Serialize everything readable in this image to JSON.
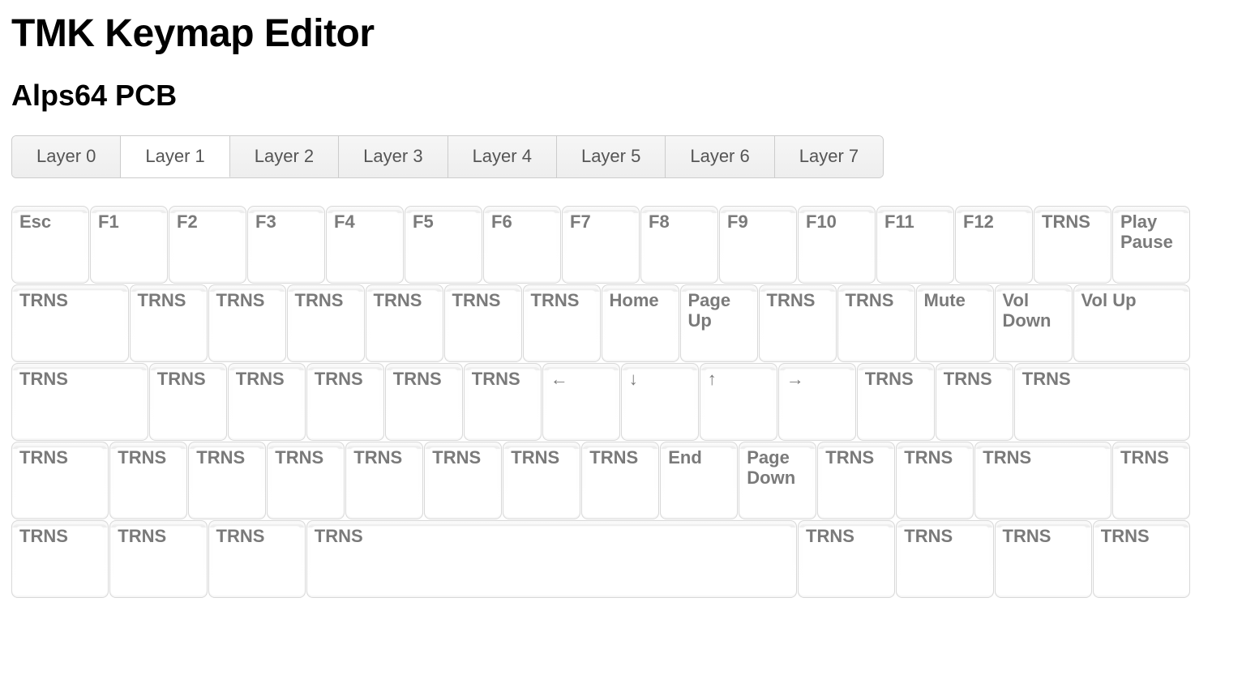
{
  "page": {
    "title": "TMK Keymap Editor",
    "subtitle": "Alps64 PCB"
  },
  "tabs": [
    {
      "label": "Layer 0",
      "active": false
    },
    {
      "label": "Layer 1",
      "active": true
    },
    {
      "label": "Layer 2",
      "active": false
    },
    {
      "label": "Layer 3",
      "active": false
    },
    {
      "label": "Layer 4",
      "active": false
    },
    {
      "label": "Layer 5",
      "active": false
    },
    {
      "label": "Layer 6",
      "active": false
    },
    {
      "label": "Layer 7",
      "active": false
    }
  ],
  "unit": 97,
  "gap": 1,
  "keys": [
    {
      "row": 0,
      "x": 0,
      "w": 1,
      "label": "Esc"
    },
    {
      "row": 0,
      "x": 1,
      "w": 1,
      "label": "F1"
    },
    {
      "row": 0,
      "x": 2,
      "w": 1,
      "label": "F2"
    },
    {
      "row": 0,
      "x": 3,
      "w": 1,
      "label": "F3"
    },
    {
      "row": 0,
      "x": 4,
      "w": 1,
      "label": "F4"
    },
    {
      "row": 0,
      "x": 5,
      "w": 1,
      "label": "F5"
    },
    {
      "row": 0,
      "x": 6,
      "w": 1,
      "label": "F6"
    },
    {
      "row": 0,
      "x": 7,
      "w": 1,
      "label": "F7"
    },
    {
      "row": 0,
      "x": 8,
      "w": 1,
      "label": "F8"
    },
    {
      "row": 0,
      "x": 9,
      "w": 1,
      "label": "F9"
    },
    {
      "row": 0,
      "x": 10,
      "w": 1,
      "label": "F10"
    },
    {
      "row": 0,
      "x": 11,
      "w": 1,
      "label": "F11"
    },
    {
      "row": 0,
      "x": 12,
      "w": 1,
      "label": "F12"
    },
    {
      "row": 0,
      "x": 13,
      "w": 1,
      "label": "TRNS"
    },
    {
      "row": 0,
      "x": 14,
      "w": 1,
      "label": "Play Pause"
    },
    {
      "row": 1,
      "x": 0,
      "w": 1.5,
      "label": "TRNS"
    },
    {
      "row": 1,
      "x": 1.5,
      "w": 1,
      "label": "TRNS"
    },
    {
      "row": 1,
      "x": 2.5,
      "w": 1,
      "label": "TRNS"
    },
    {
      "row": 1,
      "x": 3.5,
      "w": 1,
      "label": "TRNS"
    },
    {
      "row": 1,
      "x": 4.5,
      "w": 1,
      "label": "TRNS"
    },
    {
      "row": 1,
      "x": 5.5,
      "w": 1,
      "label": "TRNS"
    },
    {
      "row": 1,
      "x": 6.5,
      "w": 1,
      "label": "TRNS"
    },
    {
      "row": 1,
      "x": 7.5,
      "w": 1,
      "label": "Home"
    },
    {
      "row": 1,
      "x": 8.5,
      "w": 1,
      "label": "Page Up"
    },
    {
      "row": 1,
      "x": 9.5,
      "w": 1,
      "label": "TRNS"
    },
    {
      "row": 1,
      "x": 10.5,
      "w": 1,
      "label": "TRNS"
    },
    {
      "row": 1,
      "x": 11.5,
      "w": 1,
      "label": "Mute"
    },
    {
      "row": 1,
      "x": 12.5,
      "w": 1,
      "label": "Vol Down"
    },
    {
      "row": 1,
      "x": 13.5,
      "w": 1.5,
      "label": "Vol Up"
    },
    {
      "row": 2,
      "x": 0,
      "w": 1.75,
      "label": "TRNS"
    },
    {
      "row": 2,
      "x": 1.75,
      "w": 1,
      "label": "TRNS"
    },
    {
      "row": 2,
      "x": 2.75,
      "w": 1,
      "label": "TRNS"
    },
    {
      "row": 2,
      "x": 3.75,
      "w": 1,
      "label": "TRNS"
    },
    {
      "row": 2,
      "x": 4.75,
      "w": 1,
      "label": "TRNS"
    },
    {
      "row": 2,
      "x": 5.75,
      "w": 1,
      "label": "TRNS"
    },
    {
      "row": 2,
      "x": 6.75,
      "w": 1,
      "label": "←"
    },
    {
      "row": 2,
      "x": 7.75,
      "w": 1,
      "label": "↓"
    },
    {
      "row": 2,
      "x": 8.75,
      "w": 1,
      "label": "↑"
    },
    {
      "row": 2,
      "x": 9.75,
      "w": 1,
      "label": "→"
    },
    {
      "row": 2,
      "x": 10.75,
      "w": 1,
      "label": "TRNS"
    },
    {
      "row": 2,
      "x": 11.75,
      "w": 1,
      "label": "TRNS"
    },
    {
      "row": 2,
      "x": 12.75,
      "w": 2.25,
      "label": "TRNS"
    },
    {
      "row": 3,
      "x": 0,
      "w": 1.25,
      "label": "TRNS"
    },
    {
      "row": 3,
      "x": 1.25,
      "w": 1,
      "label": "TRNS"
    },
    {
      "row": 3,
      "x": 2.25,
      "w": 1,
      "label": "TRNS"
    },
    {
      "row": 3,
      "x": 3.25,
      "w": 1,
      "label": "TRNS"
    },
    {
      "row": 3,
      "x": 4.25,
      "w": 1,
      "label": "TRNS"
    },
    {
      "row": 3,
      "x": 5.25,
      "w": 1,
      "label": "TRNS"
    },
    {
      "row": 3,
      "x": 6.25,
      "w": 1,
      "label": "TRNS"
    },
    {
      "row": 3,
      "x": 7.25,
      "w": 1,
      "label": "TRNS"
    },
    {
      "row": 3,
      "x": 8.25,
      "w": 1,
      "label": "End"
    },
    {
      "row": 3,
      "x": 9.25,
      "w": 1,
      "label": "Page Down"
    },
    {
      "row": 3,
      "x": 10.25,
      "w": 1,
      "label": "TRNS"
    },
    {
      "row": 3,
      "x": 11.25,
      "w": 1,
      "label": "TRNS"
    },
    {
      "row": 3,
      "x": 12.25,
      "w": 1.75,
      "label": "TRNS"
    },
    {
      "row": 3,
      "x": 14,
      "w": 1,
      "label": "TRNS"
    },
    {
      "row": 4,
      "x": 0,
      "w": 1.25,
      "label": "TRNS"
    },
    {
      "row": 4,
      "x": 1.25,
      "w": 1.25,
      "label": "TRNS"
    },
    {
      "row": 4,
      "x": 2.5,
      "w": 1.25,
      "label": "TRNS"
    },
    {
      "row": 4,
      "x": 3.75,
      "w": 6.25,
      "label": "TRNS"
    },
    {
      "row": 4,
      "x": 10,
      "w": 1.25,
      "label": "TRNS"
    },
    {
      "row": 4,
      "x": 11.25,
      "w": 1.25,
      "label": "TRNS"
    },
    {
      "row": 4,
      "x": 12.5,
      "w": 1.25,
      "label": "TRNS"
    },
    {
      "row": 4,
      "x": 13.75,
      "w": 1.25,
      "label": "TRNS"
    }
  ]
}
